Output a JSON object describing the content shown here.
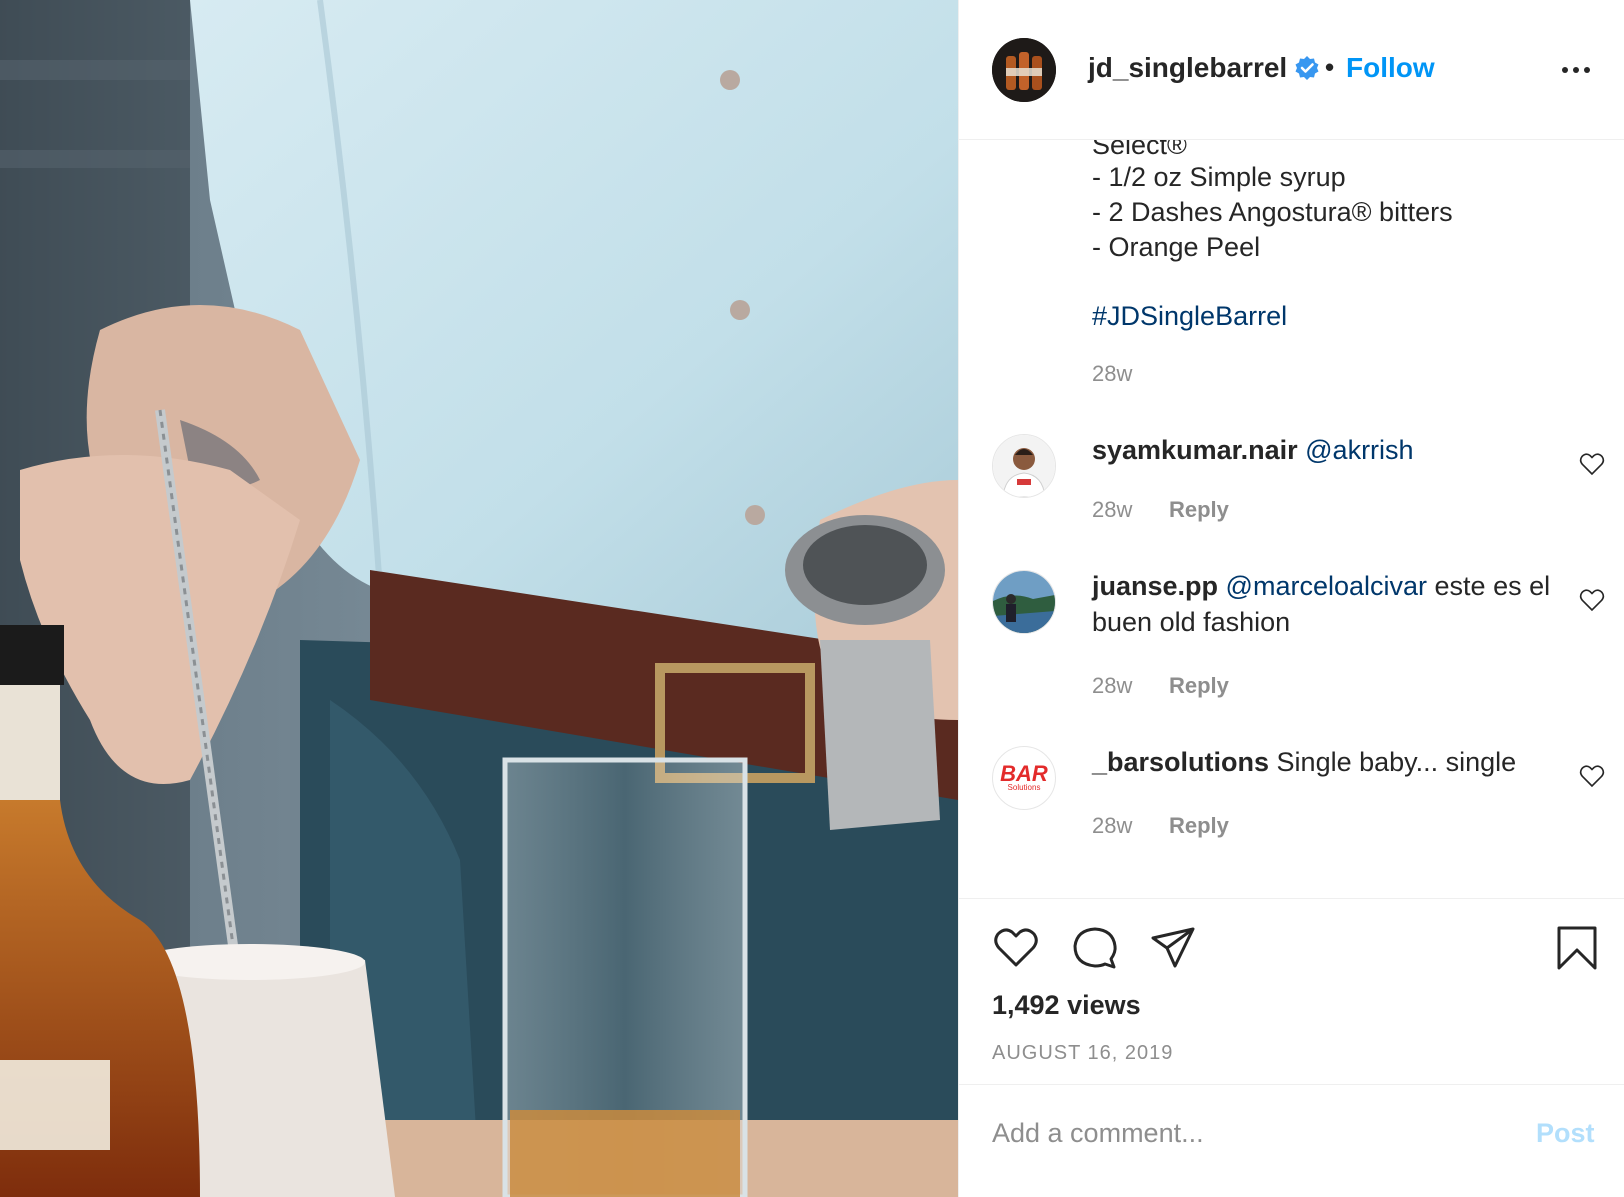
{
  "post": {
    "username": "jd_singlebarrel",
    "separator": "•",
    "follow_label": "Follow",
    "more_icon": "more-options-icon",
    "verified_icon": "verified-badge-icon"
  },
  "caption": {
    "lines": [
      "Select®",
      "- 1/2 oz Simple syrup",
      "- 2 Dashes Angostura® bitters",
      "- Orange Peel"
    ],
    "hashtag": "#JDSingleBarrel",
    "time": "28w"
  },
  "comments": [
    {
      "user": "syamkumar.nair",
      "mention": "@akrrish",
      "text": "",
      "time": "28w",
      "reply": "Reply"
    },
    {
      "user": "juanse.pp",
      "mention": "@marceloalcivar",
      "text": "este es el buen old fashion",
      "time": "28w",
      "reply": "Reply"
    },
    {
      "user": "_barsolutions",
      "mention": "",
      "text": "Single baby... single",
      "time": "28w",
      "reply": "Reply"
    }
  ],
  "bar_avatar": {
    "big": "BAR",
    "small": "Solutions"
  },
  "stats": {
    "views": "1,492 views",
    "date": "AUGUST 16, 2019"
  },
  "comment_box": {
    "placeholder": "Add a comment...",
    "post_label": "Post"
  },
  "colors": {
    "link": "#0095f6",
    "hashtag": "#00376b",
    "muted": "#8e8e8e",
    "post_disabled": "#b2dffc",
    "bar_red": "#e32b2b"
  }
}
